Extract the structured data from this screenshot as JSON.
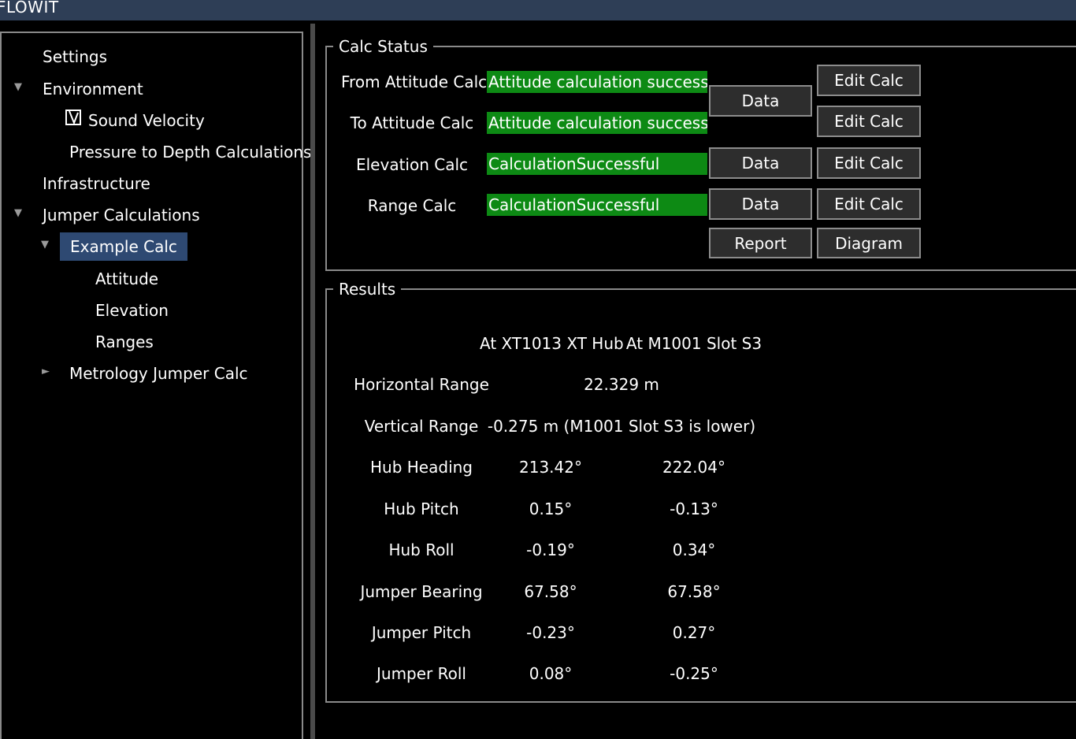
{
  "app": {
    "title": "FLOWIT"
  },
  "tree": {
    "settings": "Settings",
    "environment": "Environment",
    "sound_velocity": "Sound Velocity",
    "pressure_to_depth": "Pressure to Depth Calculations",
    "infrastructure": "Infrastructure",
    "jumper_calculations": "Jumper Calculations",
    "example_calc": "Example Calc",
    "attitude": "Attitude",
    "elevation": "Elevation",
    "ranges": "Ranges",
    "metrology_jumper_calc": "Metrology Jumper Calc"
  },
  "calc_status": {
    "title": "Calc Status",
    "rows": [
      {
        "label": "From Attitude Calc",
        "status": "Attitude calculation successful"
      },
      {
        "label": "To Attitude Calc",
        "status": "Attitude calculation successful"
      },
      {
        "label": "Elevation Calc",
        "status": "CalculationSuccessful"
      },
      {
        "label": "Range Calc",
        "status": "CalculationSuccessful"
      }
    ],
    "data_label": "Data",
    "edit_label": "Edit Calc",
    "report_label": "Report",
    "diagram_label": "Diagram",
    "status_color": "#0d8a14"
  },
  "results": {
    "title": "Results",
    "col_from": "At XT1013 XT Hub",
    "col_to": "At M1001 Slot S3",
    "horizontal_range": {
      "label": "Horizontal Range",
      "value": "22.329 m"
    },
    "vertical_range": {
      "label": "Vertical Range",
      "value": "-0.275 m (M1001 Slot S3 is lower)"
    },
    "rows": [
      {
        "label": "Hub Heading",
        "from": "213.42°",
        "to": "222.04°"
      },
      {
        "label": "Hub Pitch",
        "from": "0.15°",
        "to": "-0.13°"
      },
      {
        "label": "Hub Roll",
        "from": "-0.19°",
        "to": "0.34°"
      },
      {
        "label": "Jumper Bearing",
        "from": "67.58°",
        "to": "67.58°"
      },
      {
        "label": "Jumper Pitch",
        "from": "-0.23°",
        "to": "0.27°"
      },
      {
        "label": "Jumper Roll",
        "from": "0.08°",
        "to": "-0.25°"
      }
    ]
  }
}
